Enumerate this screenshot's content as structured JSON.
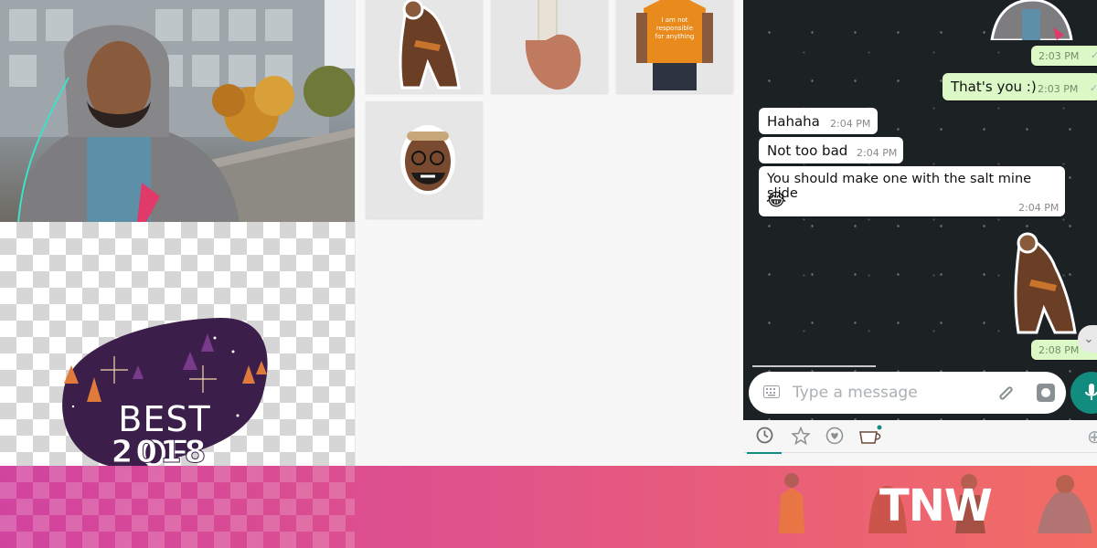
{
  "chat": {
    "messages": [
      {
        "direction": "out",
        "kind": "sticker",
        "time": "2:03 PM"
      },
      {
        "direction": "out",
        "kind": "text",
        "text": "That's you :)",
        "time": "2:03 PM"
      },
      {
        "direction": "in",
        "kind": "text",
        "text": "Hahaha",
        "time": "2:04 PM"
      },
      {
        "direction": "in",
        "kind": "text",
        "text": "Not too bad",
        "time": "2:04 PM"
      },
      {
        "direction": "in",
        "kind": "text",
        "text": "You should make one with the salt mine slide",
        "emoji": "😂",
        "time": "2:04 PM"
      },
      {
        "direction": "out",
        "kind": "sticker",
        "time": "2:08 PM"
      }
    ],
    "composer": {
      "placeholder": "Type a message"
    }
  },
  "stickers_grid": {
    "tiles": [
      "sticker-sitting-figure",
      "sticker-hand-bottle",
      "sticker-orange-shirt",
      "sticker-face-glasses"
    ],
    "shirt_text": "I am not responsible for anything"
  },
  "badge": {
    "line1": "BEST OF",
    "line2": "2018"
  },
  "sticker_tray": {
    "tabs": [
      "clock-icon",
      "star-icon",
      "heart-icon",
      "cup-icon",
      "add-icon"
    ],
    "active": 0
  },
  "banner": {
    "logo": "TNW"
  },
  "colors": {
    "banner_start": "#d13f9d",
    "banner_end": "#f2685f",
    "accent": "#128c7e",
    "outgoing_bubble": "#dcf8c6"
  }
}
